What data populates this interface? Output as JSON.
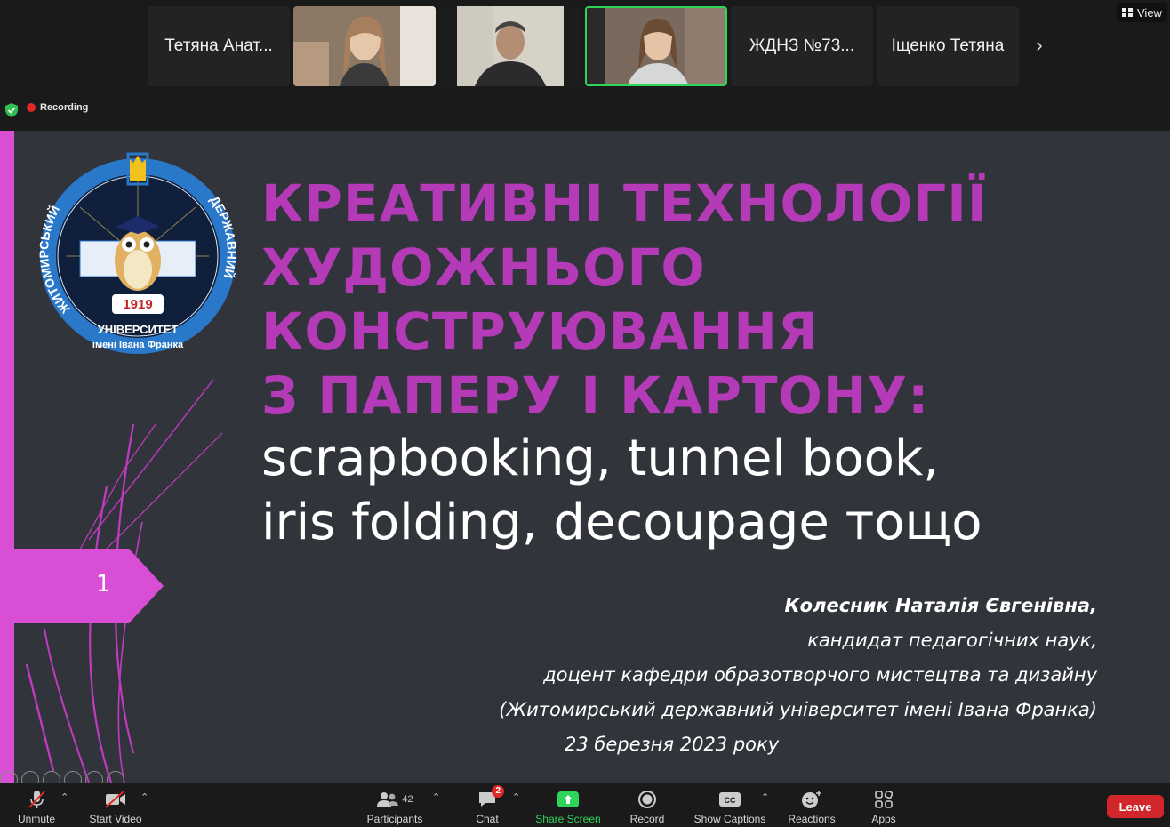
{
  "gallery": {
    "participants": [
      {
        "name": "Тетяна Анат...",
        "video": false
      },
      {
        "name": "",
        "video": true
      },
      {
        "name": "",
        "video": true
      },
      {
        "name": "",
        "video": true,
        "active": true
      },
      {
        "name": "ЖДНЗ №73...",
        "video": false
      },
      {
        "name": "Іщенко Тетяна",
        "video": false
      }
    ],
    "view_label": "View",
    "recording_label": "Recording"
  },
  "slide": {
    "title_lines": [
      "КРЕАТИВНІ ТЕХНОЛОГІЇ",
      "ХУДОЖНЬОГО",
      "КОНСТРУЮВАННЯ",
      "З ПАПЕРУ І КАРТОНУ:"
    ],
    "subtitle_lines": [
      "scrapbooking, tunnel book,",
      "iris folding, decoupage тощо"
    ],
    "slide_number": "1",
    "author_name": "Колесник Наталія Євгенівна,",
    "author_lines": [
      "кандидат педагогічних наук,",
      "доцент кафедри образотворчого мистецтва та дизайну",
      "(Житомирський державний університет імені Івана Франка)"
    ],
    "date": "23 березня 2023 року",
    "logo": {
      "year": "1919",
      "ring_text_left": "ЖИТОМИРСЬКИЙ",
      "ring_text_right": "ДЕРЖАВНИЙ",
      "ring_text_bottom": "УНІВЕРСИТЕТ",
      "ring_text_bottom2": "імені Івана Франка"
    },
    "accent_color": "#b53ab8",
    "stripe_color": "#d84fd6",
    "background_color": "#31343b"
  },
  "toolbar": {
    "unmute": "Unmute",
    "start_video": "Start Video",
    "participants": "Participants",
    "participants_count": "42",
    "chat": "Chat",
    "chat_badge": "2",
    "share_screen": "Share Screen",
    "record": "Record",
    "show_captions": "Show Captions",
    "reactions": "Reactions",
    "apps": "Apps",
    "leave": "Leave",
    "share_color": "#2fd45b",
    "leave_color": "#d0262c"
  }
}
